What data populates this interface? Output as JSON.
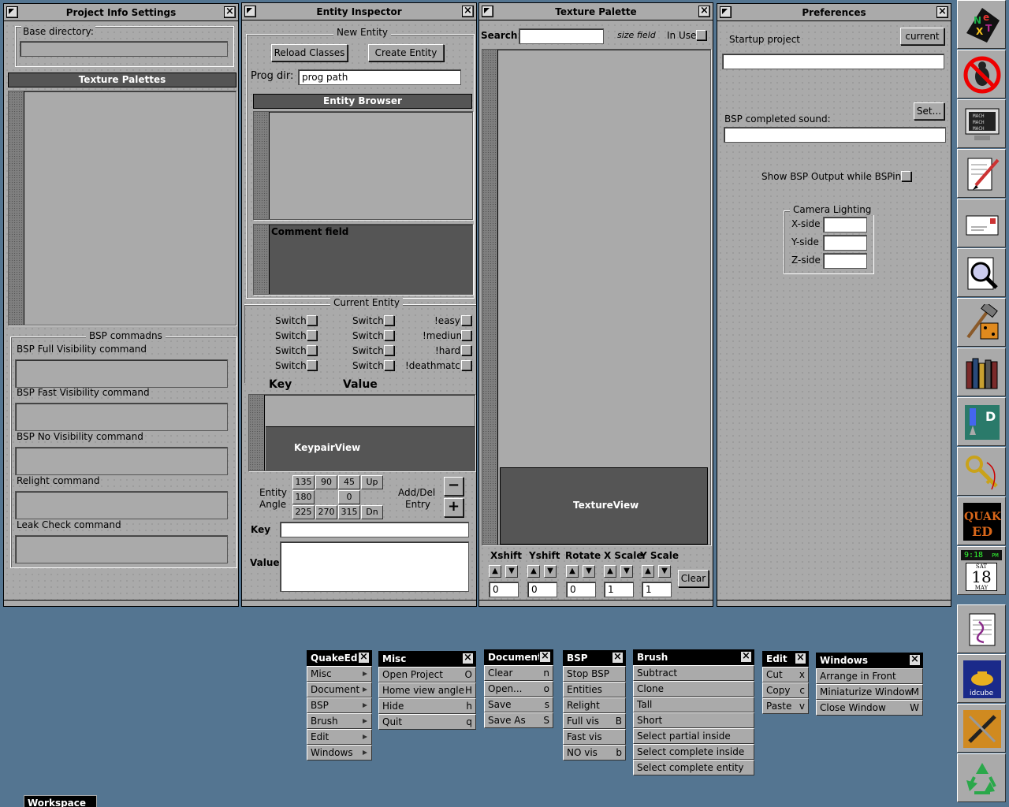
{
  "project_info": {
    "title": "Project Info Settings",
    "base_dir_label": "Base directory:",
    "base_dir_value": "",
    "texture_palettes_header": "Texture Palettes",
    "bsp_group_title": "BSP commadns",
    "commands": [
      {
        "label": "BSP Full Visibility command",
        "value": ""
      },
      {
        "label": "BSP Fast Visibility command",
        "value": ""
      },
      {
        "label": "BSP No Visibility command",
        "value": ""
      },
      {
        "label": "Relight command",
        "value": ""
      },
      {
        "label": "Leak Check command",
        "value": ""
      }
    ]
  },
  "entity_inspector": {
    "title": "Entity Inspector",
    "new_entity_title": "New Entity",
    "reload_classes": "Reload Classes",
    "create_entity": "Create Entity",
    "prog_dir_label": "Prog dir:",
    "prog_dir_value": "prog path",
    "entity_browser_header": "Entity Browser",
    "comment_field": "Comment field",
    "current_entity_title": "Current Entity",
    "flags_col1": [
      "Switch",
      "Switch",
      "Switch",
      "Switch"
    ],
    "flags_col2": [
      "Switch",
      "Switch",
      "Switch",
      "Switch"
    ],
    "flags_col3": [
      "!easy",
      "!medium",
      "!hard",
      "!deathmatch"
    ],
    "key_header": "Key",
    "value_header": "Value",
    "keypair_view": "KeypairView",
    "entity_angle_label_1": "Entity",
    "entity_angle_label_2": "Angle",
    "angles_row1": [
      "135",
      "90",
      "45",
      "Up"
    ],
    "angles_row2": [
      "180",
      "",
      "0",
      ""
    ],
    "angles_row3": [
      "225",
      "270",
      "315",
      "Dn"
    ],
    "add_del_label_1": "Add/Del",
    "add_del_label_2": "Entry",
    "minus": "−",
    "plus": "+",
    "key_label": "Key",
    "key_value": "",
    "value_label": "Value",
    "value_value": ""
  },
  "texture_palette": {
    "title": "Texture Palette",
    "search_label": "Search:",
    "search_value": "",
    "size_field": "size field",
    "in_use": "In Use",
    "texture_view": "TextureView",
    "xshift": "Xshift",
    "yshift": "Yshift",
    "rotate": "Rotate",
    "xscale": "X Scale",
    "yscale": "Y Scale",
    "xshift_value": "0",
    "yshift_value": "0",
    "rotate_value": "0",
    "xscale_value": "1",
    "yscale_value": "1",
    "clear": "Clear"
  },
  "preferences": {
    "title": "Preferences",
    "startup_project": "Startup project",
    "current": "current",
    "startup_value": "",
    "set": "Set...",
    "bsp_sound": "BSP completed sound:",
    "bsp_sound_value": "",
    "show_bsp_output": "Show BSP Output while BSPing",
    "camera_lighting": "Camera Lighting",
    "x_side": "X-side",
    "y_side": "Y-side",
    "z_side": "Z-side"
  },
  "menus": {
    "quakeed": {
      "title": "QuakeEd",
      "items": [
        "Misc",
        "Document",
        "BSP",
        "Brush",
        "Edit",
        "Windows"
      ]
    },
    "misc": {
      "title": "Misc",
      "items": [
        {
          "label": "Open Project",
          "key": "O"
        },
        {
          "label": "Home view angle",
          "key": "H"
        },
        {
          "label": "Hide",
          "key": "h"
        },
        {
          "label": "Quit",
          "key": "q"
        }
      ]
    },
    "document": {
      "title": "Document",
      "items": [
        {
          "label": "Clear",
          "key": "n"
        },
        {
          "label": "Open...",
          "key": "o"
        },
        {
          "label": "Save",
          "key": "s"
        },
        {
          "label": "Save As",
          "key": "S"
        }
      ]
    },
    "bsp": {
      "title": "BSP",
      "items": [
        {
          "label": "Stop BSP",
          "key": ""
        },
        {
          "label": "Entities",
          "key": ""
        },
        {
          "label": "Relight",
          "key": ""
        },
        {
          "label": "Full vis",
          "key": "B"
        },
        {
          "label": "Fast vis",
          "key": ""
        },
        {
          "label": "NO vis",
          "key": "b"
        }
      ]
    },
    "brush": {
      "title": "Brush",
      "items": [
        "Subtract",
        "Clone",
        "Tall",
        "Short",
        "Select partial inside",
        "Select complete inside",
        "Select complete entity"
      ]
    },
    "edit": {
      "title": "Edit",
      "items": [
        {
          "label": "Cut",
          "key": "x"
        },
        {
          "label": "Copy",
          "key": "c"
        },
        {
          "label": "Paste",
          "key": "v"
        }
      ]
    },
    "windows": {
      "title": "Windows",
      "items": [
        {
          "label": "Arrange in Front",
          "key": ""
        },
        {
          "label": "Miniaturize Window",
          "key": "M"
        },
        {
          "label": "Close Window",
          "key": "W"
        }
      ]
    }
  },
  "dock": {
    "clock_time": "9:18",
    "clock_ampm": "PM",
    "clock_day": "SAT",
    "clock_date": "18",
    "clock_month": "MAY",
    "quake_label_1": "QUAKE",
    "quake_label_2": "ED",
    "idcube_label": "idcube",
    "mach_label": "MACH"
  },
  "workspace": {
    "label": "Workspace"
  }
}
